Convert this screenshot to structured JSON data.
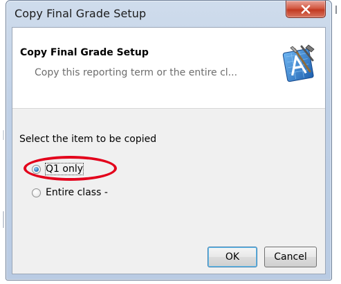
{
  "window": {
    "title": "Copy Final Grade Setup"
  },
  "header": {
    "title": "Copy Final Grade Setup",
    "subtitle": "Copy this reporting term or the entire cl..."
  },
  "body": {
    "section_label": "Select the item to be copied",
    "options": [
      {
        "label": "Q1 only",
        "selected": true
      },
      {
        "label": "Entire class -",
        "selected": false
      }
    ]
  },
  "buttons": {
    "ok_label": "OK",
    "cancel_label": "Cancel"
  },
  "colors": {
    "annotation": "#e3001b",
    "close_button": "#c23a22",
    "accent": "#1f6fb4"
  },
  "icons": {
    "close": "close-icon",
    "wizard": "wizard-tools-icon"
  }
}
